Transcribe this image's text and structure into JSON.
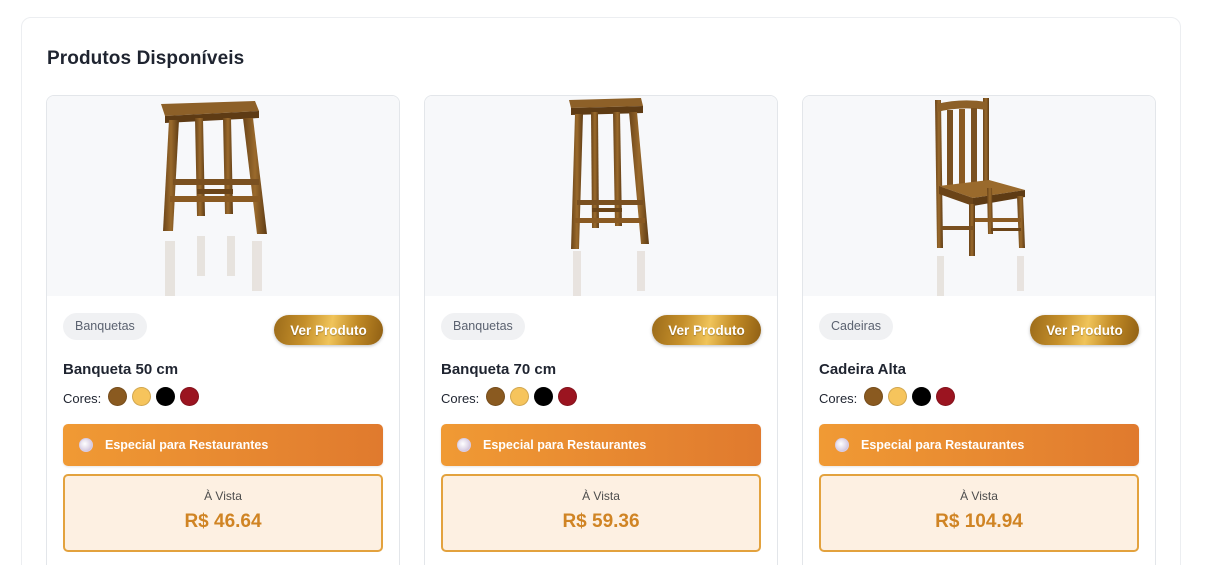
{
  "section": {
    "title": "Produtos Disponíveis"
  },
  "products": [
    {
      "category": "Banquetas",
      "button_label": "Ver Produto",
      "name": "Banqueta 50 cm",
      "colors_label": "Cores:",
      "colors": [
        "#8a5a20",
        "#f6c45c",
        "#000000",
        "#9b1420"
      ],
      "special_label": "Especial para Restaurantes",
      "price_label": "À Vista",
      "price": "R$ 46.64",
      "image_icon": "stool-50-image"
    },
    {
      "category": "Banquetas",
      "button_label": "Ver Produto",
      "name": "Banqueta 70 cm",
      "colors_label": "Cores:",
      "colors": [
        "#8a5a20",
        "#f6c45c",
        "#000000",
        "#9b1420"
      ],
      "special_label": "Especial para Restaurantes",
      "price_label": "À Vista",
      "price": "R$ 59.36",
      "image_icon": "stool-70-image"
    },
    {
      "category": "Cadeiras",
      "button_label": "Ver Produto",
      "name": "Cadeira Alta",
      "colors_label": "Cores:",
      "colors": [
        "#8a5a20",
        "#f6c45c",
        "#000000",
        "#9b1420"
      ],
      "special_label": "Especial para Restaurantes",
      "price_label": "À Vista",
      "price": "R$ 104.94",
      "image_icon": "chair-image"
    }
  ]
}
